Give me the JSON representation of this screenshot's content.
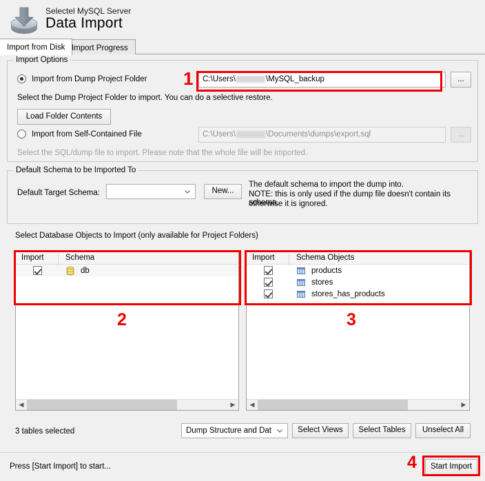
{
  "window": {
    "app_subtitle": "Selectel MySQL Server",
    "app_title": "Data Import",
    "icon": "import-disc-arrow-icon"
  },
  "tabs": [
    {
      "label": "Import from Disk",
      "active": true
    },
    {
      "label": "Import Progress",
      "active": false
    }
  ],
  "import_options": {
    "group_title": "Import Options",
    "dump_folder": {
      "radio_label": "Import from Dump Project Folder",
      "selected": true,
      "path_prefix": "C:\\Users\\",
      "path_suffix": "\\MySQL_backup",
      "redacted": true,
      "browse_label": "...",
      "hint": "Select the Dump Project Folder to import. You can do a selective restore.",
      "load_button": "Load Folder Contents"
    },
    "self_contained": {
      "radio_label": "Import from Self-Contained File",
      "selected": false,
      "path_prefix": "C:\\Users\\",
      "path_suffix": "\\Documents\\dumps\\export.sql",
      "redacted": true,
      "browse_label": "...",
      "hint": "Select the SQL/dump file to import. Please note that the whole file will be imported."
    }
  },
  "default_schema": {
    "group_title": "Default Schema to be Imported To",
    "field_label": "Default Target Schema:",
    "selected_value": "",
    "new_button": "New...",
    "note_line_1": "The default schema to import the dump into.",
    "note_line_2": "NOTE: this is only used if the dump file doesn't contain its schema,",
    "note_line_3": "otherwise it is ignored."
  },
  "objects": {
    "group_title": "Select Database Objects to Import (only available for Project Folders)",
    "schema_list": {
      "columns": [
        "Import",
        "Schema"
      ],
      "rows": [
        {
          "checked": true,
          "name": "db",
          "icon": "database-icon"
        }
      ]
    },
    "object_list": {
      "columns": [
        "Import",
        "Schema Objects"
      ],
      "rows": [
        {
          "checked": true,
          "name": "products",
          "icon": "table-icon"
        },
        {
          "checked": true,
          "name": "stores",
          "icon": "table-icon"
        },
        {
          "checked": true,
          "name": "stores_has_products",
          "icon": "table-icon"
        }
      ]
    }
  },
  "bottom_bar": {
    "selection_status": "3 tables selected",
    "dump_mode_value": "Dump Structure and Dat",
    "select_views": "Select Views",
    "select_tables": "Select Tables",
    "unselect_all": "Unselect All"
  },
  "footer": {
    "status": "Press [Start Import] to start...",
    "start_button": "Start Import"
  },
  "annotations": {
    "one": "1",
    "two": "2",
    "three": "3",
    "four": "4",
    "color": "#ee0000"
  }
}
